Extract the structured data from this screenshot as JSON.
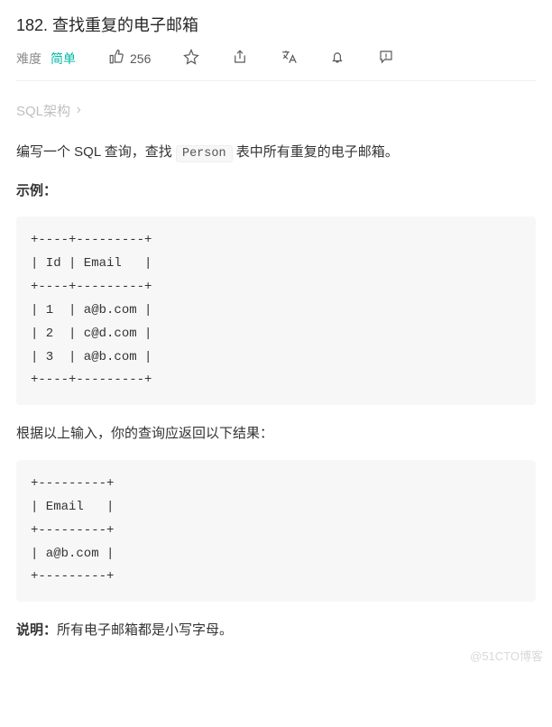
{
  "title": "182. 查找重复的电子邮箱",
  "meta": {
    "difficulty_label": "难度",
    "difficulty_value": "简单",
    "likes": "256"
  },
  "schema_link": "SQL架构",
  "content": {
    "intro_before": "编写一个 SQL 查询，查找 ",
    "intro_code": "Person",
    "intro_after": " 表中所有重复的电子邮箱。",
    "example_label": "示例：",
    "example_block": "+----+---------+\n| Id | Email   |\n+----+---------+\n| 1  | a@b.com |\n| 2  | c@d.com |\n| 3  | a@b.com |\n+----+---------+",
    "result_text": "根据以上输入，你的查询应返回以下结果：",
    "result_block": "+---------+\n| Email   |\n+---------+\n| a@b.com |\n+---------+",
    "note_label": "说明：",
    "note_text": "所有电子邮箱都是小写字母。"
  },
  "watermark": "@51CTO博客"
}
